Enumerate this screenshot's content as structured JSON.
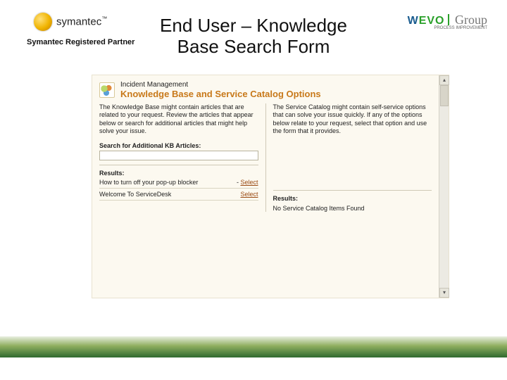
{
  "header": {
    "symantec_name": "symantec",
    "symantec_tm": "™",
    "registered_partner": "Symantec Registered Partner",
    "wevo_w": "W",
    "wevo_rest": "EVO",
    "wevo_group": " Group",
    "wevo_tag": "PROCESS IMPROVEMENT"
  },
  "title": {
    "line1": "End User – Knowledge",
    "line2": "Base Search Form"
  },
  "screenshot": {
    "breadcrumb": "Incident Management",
    "heading": "Knowledge Base and Service Catalog Options",
    "kb_desc": "The Knowledge Base might contain articles that are related to your request. Review the articles that appear below or search for additional articles that might help solve your issue.",
    "sc_desc": "The Service Catalog might contain self-service options that can solve your issue quickly. If any of the options below relate to your request, select that option and use the form that it provides.",
    "search_label": "Search for Additional KB Articles:",
    "results_label_left": "Results:",
    "results_label_right": "Results:",
    "kb_rows": [
      {
        "title": "How to turn off your pop-up blocker",
        "action": "Select"
      },
      {
        "title": "Welcome To ServiceDesk",
        "action": "Select"
      }
    ],
    "sc_empty": "No Service Catalog Items Found",
    "scroll_up": "▴",
    "scroll_down": "▾"
  }
}
